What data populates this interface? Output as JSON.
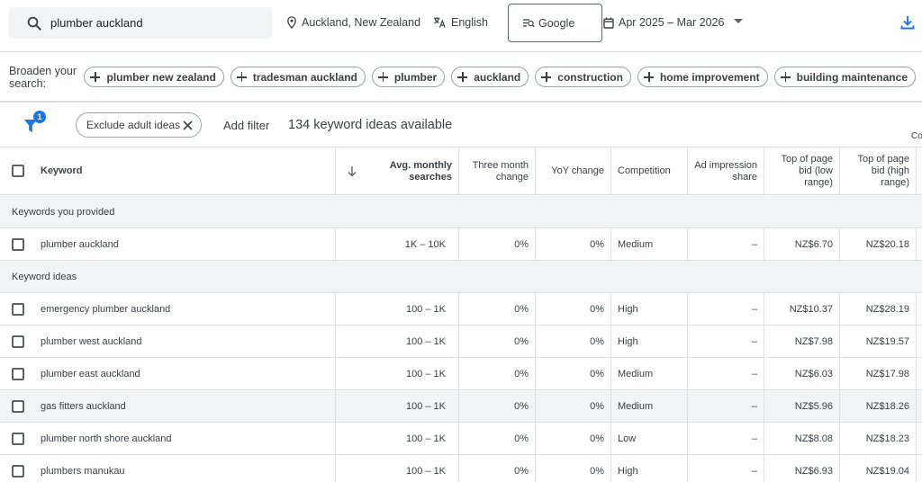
{
  "topbar": {
    "search_value": "plumber auckland",
    "location": "Auckland, New Zealand",
    "language": "English",
    "network": "Google",
    "date_range": "Apr 2025 – Mar 2026"
  },
  "broaden": {
    "label": "Broaden your search:",
    "chips": [
      "plumber new zealand",
      "tradesman auckland",
      "plumber",
      "auckland",
      "construction",
      "home improvement",
      "building maintenance"
    ]
  },
  "filters": {
    "badge_count": "1",
    "chip_label": "Exclude adult ideas",
    "add_filter": "Add filter",
    "ideas_count": "134 keyword ideas available",
    "cut_text": "Co"
  },
  "table": {
    "headers": {
      "keyword": "Keyword",
      "avg": [
        "Avg. monthly",
        "searches"
      ],
      "three_month": [
        "Three month",
        "change"
      ],
      "yoy": "YoY change",
      "competition": "Competition",
      "impression": [
        "Ad impression",
        "share"
      ],
      "bid_low": [
        "Top of page",
        "bid (low",
        "range)"
      ],
      "bid_high": [
        "Top of page",
        "bid (high",
        "range)"
      ]
    },
    "group_provided": "Keywords you provided",
    "group_ideas": "Keyword ideas",
    "provided_rows": [
      {
        "keyword": "plumber auckland",
        "avg": "1K – 10K",
        "three": "0%",
        "yoy": "0%",
        "comp": "Medium",
        "imp": "–",
        "low": "NZ$6.70",
        "high": "NZ$20.18"
      }
    ],
    "idea_rows": [
      {
        "keyword": "emergency plumber auckland",
        "avg": "100 – 1K",
        "three": "0%",
        "yoy": "0%",
        "comp": "High",
        "imp": "–",
        "low": "NZ$10.37",
        "high": "NZ$28.19"
      },
      {
        "keyword": "plumber west auckland",
        "avg": "100 – 1K",
        "three": "0%",
        "yoy": "0%",
        "comp": "High",
        "imp": "–",
        "low": "NZ$7.98",
        "high": "NZ$19.57"
      },
      {
        "keyword": "plumber east auckland",
        "avg": "100 – 1K",
        "three": "0%",
        "yoy": "0%",
        "comp": "Medium",
        "imp": "–",
        "low": "NZ$6.03",
        "high": "NZ$17.98"
      },
      {
        "keyword": "gas fitters auckland",
        "avg": "100 – 1K",
        "three": "0%",
        "yoy": "0%",
        "comp": "Medium",
        "imp": "–",
        "low": "NZ$5.96",
        "high": "NZ$18.26"
      },
      {
        "keyword": "plumber north shore auckland",
        "avg": "100 – 1K",
        "three": "0%",
        "yoy": "0%",
        "comp": "Low",
        "imp": "–",
        "low": "NZ$8.08",
        "high": "NZ$18.23"
      },
      {
        "keyword": "plumbers manukau",
        "avg": "100 – 1K",
        "three": "0%",
        "yoy": "0%",
        "comp": "High",
        "imp": "–",
        "low": "NZ$6.93",
        "high": "NZ$19.04"
      }
    ]
  },
  "icons": {
    "search": "search-icon",
    "location": "location-pin-icon",
    "language": "translate-icon",
    "network": "network-icon",
    "calendar": "calendar-icon",
    "dropdown": "dropdown-arrow-icon",
    "download": "download-icon",
    "filter": "filter-icon",
    "close": "close-icon",
    "sort": "sort-down-icon"
  },
  "colors": {
    "accent": "#1a73e8",
    "highlight_row": "#f1f3f4"
  }
}
